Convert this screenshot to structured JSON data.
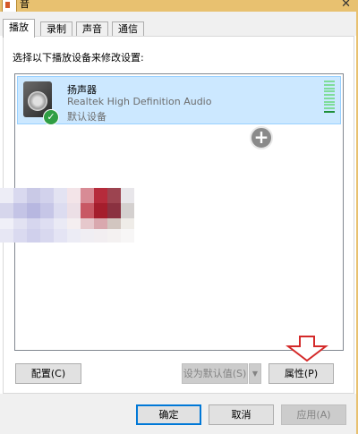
{
  "window": {
    "title": "音",
    "close_symbol": "✕"
  },
  "tabs": [
    {
      "label": "播放"
    },
    {
      "label": "录制"
    },
    {
      "label": "声音"
    },
    {
      "label": "通信"
    }
  ],
  "instruction": "选择以下播放设备来修改设置:",
  "device": {
    "name": "扬声器",
    "driver": "Realtek High Definition Audio",
    "status": "默认设备",
    "check_symbol": "✓",
    "level_fraction": 0.1
  },
  "plus_symbol": "+",
  "buttons": {
    "configure": "配置(C)",
    "set_default": "设为默认值(S)",
    "set_default_arrow": "▼",
    "properties": "属性(P)",
    "ok": "确定",
    "cancel": "取消",
    "apply": "应用(A)"
  }
}
